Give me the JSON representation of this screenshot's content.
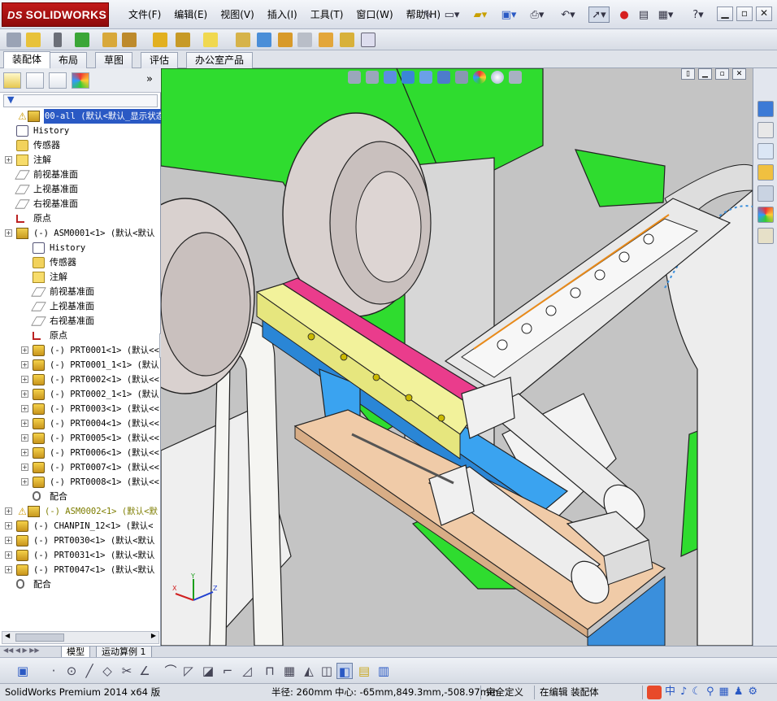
{
  "app": {
    "brand": "SOLIDWORKS",
    "brand_prefix": "DS"
  },
  "menu": [
    "文件(F)",
    "编辑(E)",
    "视图(V)",
    "插入(I)",
    "工具(T)",
    "窗口(W)",
    "帮助(H)"
  ],
  "command_tabs": [
    "装配体",
    "布局",
    "草图",
    "评估",
    "办公室产品"
  ],
  "active_command_tab": "装配体",
  "feature_tree": {
    "root": "00-all  (默认<默认_显示状态",
    "rows": [
      {
        "label": "History"
      },
      {
        "label": "传感器"
      },
      {
        "label": "注解"
      },
      {
        "label": "前视基准面"
      },
      {
        "label": "上视基准面"
      },
      {
        "label": "右视基准面"
      },
      {
        "label": "原点"
      },
      {
        "label": "(-) ASM0001<1> (默认<默认"
      },
      {
        "label": "History"
      },
      {
        "label": "传感器"
      },
      {
        "label": "注解"
      },
      {
        "label": "前视基准面"
      },
      {
        "label": "上视基准面"
      },
      {
        "label": "右视基准面"
      },
      {
        "label": "原点"
      },
      {
        "label": "(-) PRT0001<1> (默认<<"
      },
      {
        "label": "(-) PRT0001_1<1> (默认"
      },
      {
        "label": "(-) PRT0002<1> (默认<<"
      },
      {
        "label": "(-) PRT0002_1<1> (默认"
      },
      {
        "label": "(-) PRT0003<1> (默认<<"
      },
      {
        "label": "(-) PRT0004<1> (默认<<"
      },
      {
        "label": "(-) PRT0005<1> (默认<<"
      },
      {
        "label": "(-) PRT0006<1> (默认<<"
      },
      {
        "label": "(-) PRT0007<1> (默认<<"
      },
      {
        "label": "(-) PRT0008<1> (默认<<"
      },
      {
        "label": "配合"
      },
      {
        "label": "(-) ASM0002<1> (默认<默"
      },
      {
        "label": "(-) CHANPIN_12<1> (默认<"
      },
      {
        "label": "(-) PRT0030<1> (默认<默认"
      },
      {
        "label": "(-) PRT0031<1> (默认<默认"
      },
      {
        "label": "(-) PRT0047<1> (默认<默认"
      },
      {
        "label": "配合"
      }
    ]
  },
  "model_tabs": [
    "模型",
    "运动算例 1"
  ],
  "active_model_tab": "模型",
  "status": {
    "product": "SolidWorks Premium 2014 x64 版",
    "radius": "半径: 260mm",
    "center": "中心: -65mm,849.3mm,-508.97mm",
    "definition": "完全定义",
    "mode": "在编辑 装配体"
  },
  "colors": {
    "accent_selection": "#2a59c4",
    "brand_red": "#c21a1a",
    "model_green": "#2fdc2f",
    "model_blue": "#3aa3f0",
    "model_yellow": "#f2f29b",
    "model_magenta": "#ea3c8c",
    "model_tan": "#f0cba8"
  },
  "icons": [
    "new-icon",
    "open-icon",
    "save-icon",
    "print-icon",
    "undo-icon",
    "select-icon",
    "rebuild-icon",
    "options-icon",
    "help-icon",
    "minimize-icon",
    "restore-icon",
    "close-icon"
  ]
}
